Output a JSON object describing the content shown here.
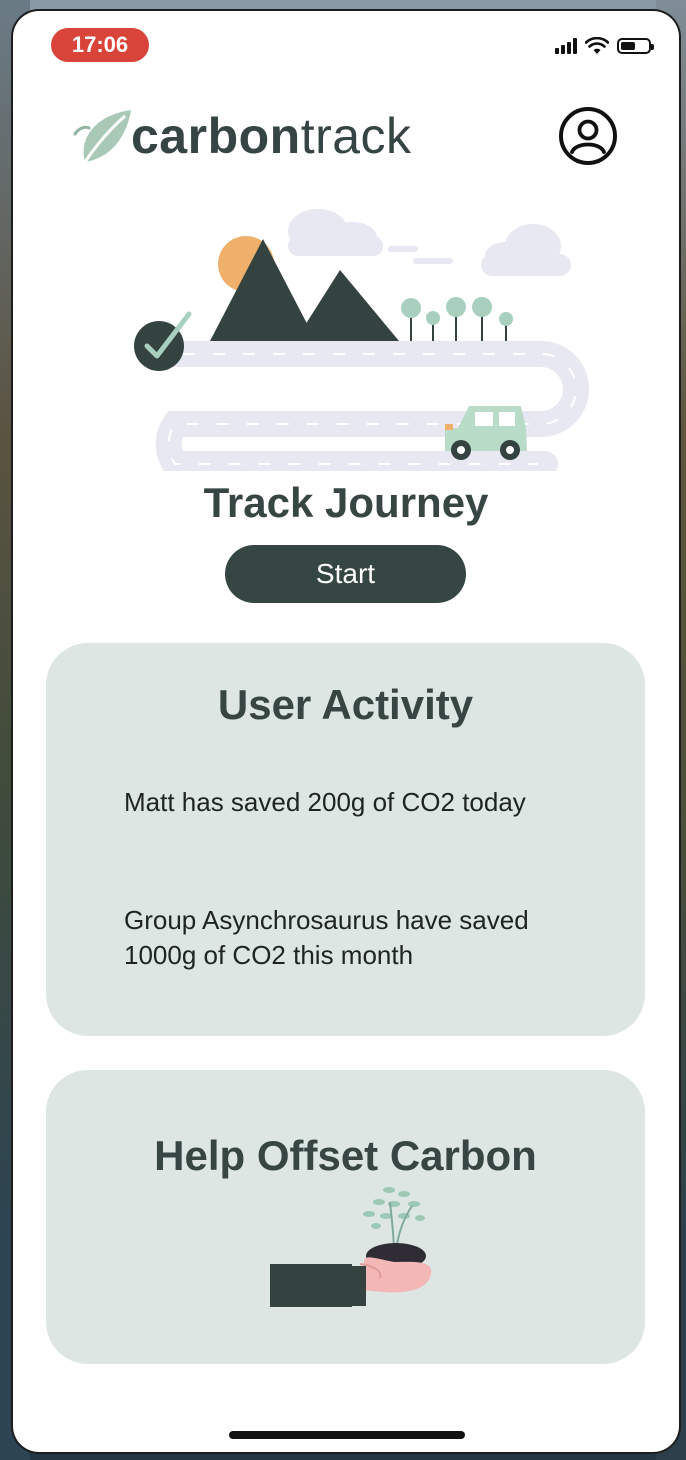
{
  "status_bar": {
    "time": "17:06",
    "icons": [
      "cellular-signal-icon",
      "wifi-icon",
      "battery-icon"
    ]
  },
  "header": {
    "logo_bold": "carbon",
    "logo_light": "track",
    "profile_icon": "user-profile-icon"
  },
  "hero": {
    "title": "Track Journey",
    "start_label": "Start"
  },
  "user_activity": {
    "title": "User Activity",
    "items": [
      "Matt has saved 200g of CO2 today",
      "Group Asynchrosaurus have saved 1000g of CO2 this month"
    ]
  },
  "offset": {
    "title": "Help Offset Carbon"
  },
  "colors": {
    "brand_dark": "#364642",
    "card_bg": "#dde6e3",
    "time_badge": "#d8443a",
    "leaf_green": "#a9c9b6"
  }
}
